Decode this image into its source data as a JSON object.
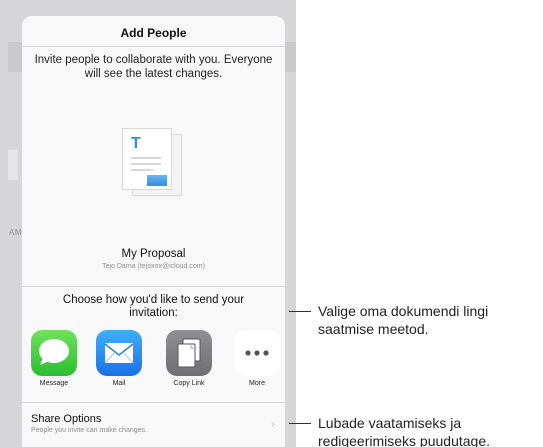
{
  "background_app": {
    "side_label": "AM"
  },
  "sheet": {
    "title": "Add People",
    "intro": "Invite people to collaborate with you. Everyone will see the latest changes.",
    "document": {
      "thumbnail_letter": "T",
      "name": "My Proposal",
      "owner": "Tejo Dama (tejoxox@icloud.com)"
    },
    "choose_prompt": "Choose how you'd like to send your invitation:",
    "targets": [
      {
        "label": "Message",
        "icon": "message-icon"
      },
      {
        "label": "Mail",
        "icon": "mail-icon"
      },
      {
        "label": "Copy Link",
        "icon": "copy-link-icon"
      },
      {
        "label": "More",
        "icon": "more-icon"
      }
    ],
    "share_options": {
      "title": "Share Options",
      "subtitle": "People you invite can make changes.",
      "chevron": "›"
    }
  },
  "callouts": {
    "send_method": "Valige oma dokumendi lingi saatmise meetod.",
    "share_options": "Lubade vaatamiseks ja redigeerimiseks puudutage."
  },
  "colors": {
    "message": "#2bbd32",
    "mail": "#1a70e8",
    "copy_link": "#7a7a7f",
    "doc_accent": "#2f8fe0"
  }
}
